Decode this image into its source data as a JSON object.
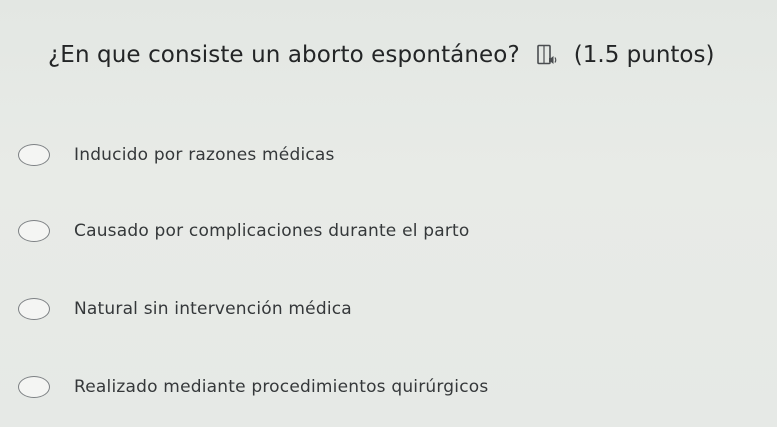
{
  "question": {
    "text": "¿En que consiste un aborto espontáneo?",
    "audio_icon": "immersive-reader-audio-icon",
    "points": "(1.5 puntos)"
  },
  "options": [
    {
      "label": "Inducido por razones médicas",
      "selected": false
    },
    {
      "label": "Causado por complicaciones durante el parto",
      "selected": false
    },
    {
      "label": "Natural sin intervención médica",
      "selected": false
    },
    {
      "label": "Realizado mediante procedimientos quirúrgicos",
      "selected": false
    }
  ]
}
